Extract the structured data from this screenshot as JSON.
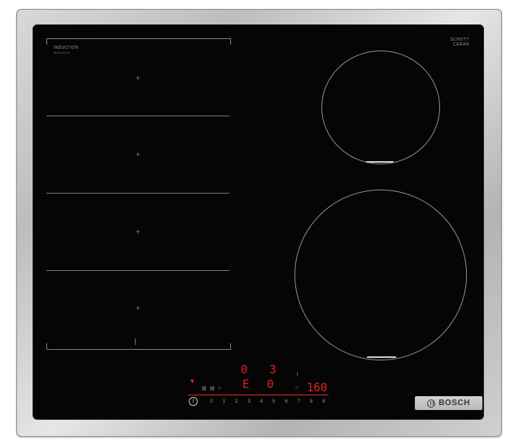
{
  "cooktop": {
    "brand": "BOSCH",
    "induction_label": "INDUCTION",
    "flex_sublabel": "flexInduction",
    "glass_maker": "SCHOTT\nCERAN",
    "glass_maker_sub": "ceran",
    "colors": {
      "frame": "#c8c8c8",
      "glass": "#050505",
      "display_red": "#e2231a"
    }
  },
  "display": {
    "zone_power_a": "0",
    "zone_power_b": "3",
    "zone_power_c": "0",
    "zone_mode": "E",
    "timer": "160",
    "power_scale": [
      "0",
      "1",
      "2",
      "3",
      "4",
      "5",
      "6",
      "7",
      "8",
      "9"
    ]
  },
  "icons": {
    "flex_zone_icon": "flex-induction-icon",
    "power": "power-icon",
    "bosch_logo": "bosch-logo-icon"
  }
}
